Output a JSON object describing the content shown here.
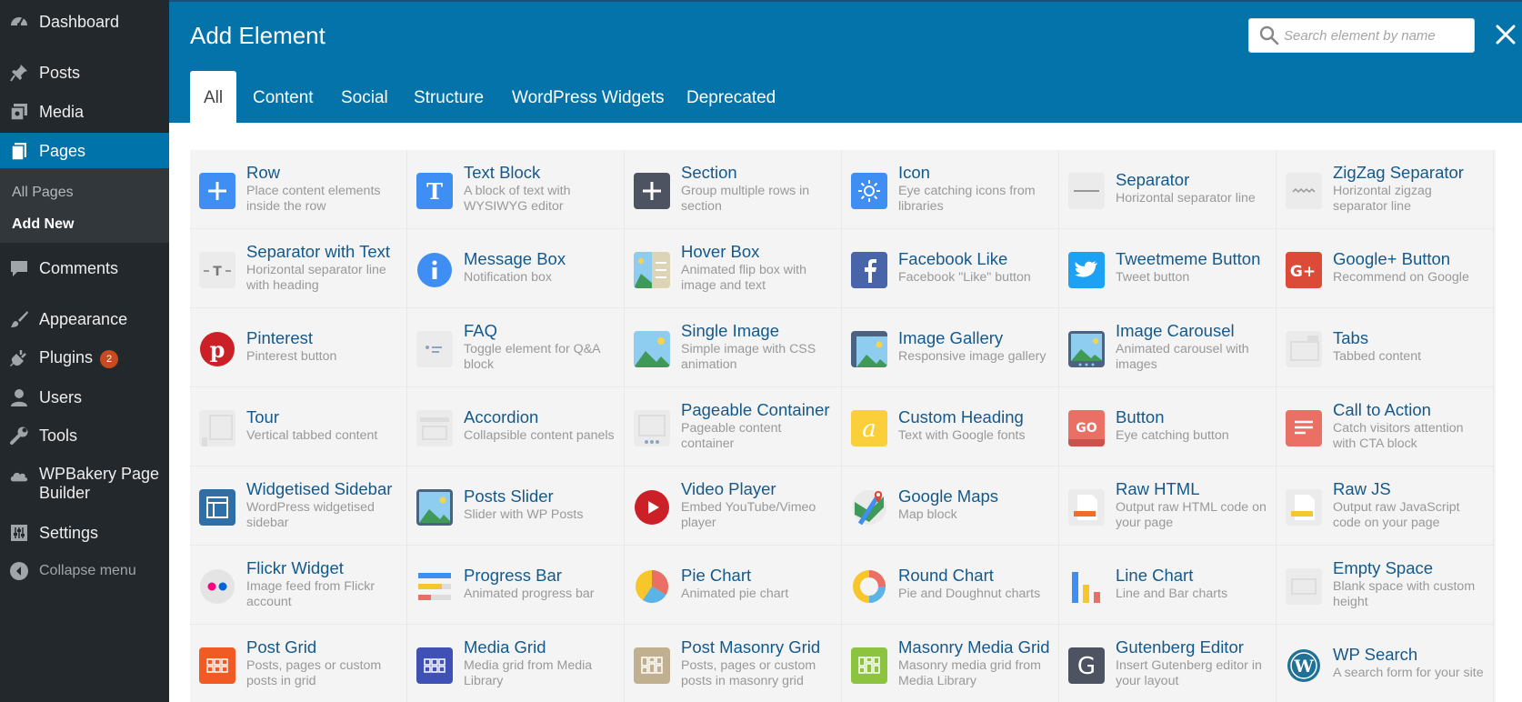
{
  "sidebar": {
    "items": [
      {
        "key": "dashboard",
        "label": "Dashboard",
        "icon": "gauge-icon"
      },
      {
        "key": "posts",
        "label": "Posts",
        "icon": "pushpin-icon"
      },
      {
        "key": "media",
        "label": "Media",
        "icon": "media-icon"
      },
      {
        "key": "pages",
        "label": "Pages",
        "icon": "pages-icon"
      },
      {
        "key": "comments",
        "label": "Comments",
        "icon": "comment-icon"
      },
      {
        "key": "appearance",
        "label": "Appearance",
        "icon": "paintbrush-icon"
      },
      {
        "key": "plugins",
        "label": "Plugins",
        "icon": "plug-icon"
      },
      {
        "key": "users",
        "label": "Users",
        "icon": "user-icon"
      },
      {
        "key": "tools",
        "label": "Tools",
        "icon": "wrench-icon"
      },
      {
        "key": "wpbakery",
        "label": "WPBakery Page Builder",
        "icon": "cloud-icon"
      },
      {
        "key": "settings",
        "label": "Settings",
        "icon": "sliders-icon"
      }
    ],
    "submenu": {
      "all_pages": "All Pages",
      "add_new": "Add New"
    },
    "plugins_badge": "2",
    "collapse_label": "Collapse menu"
  },
  "modal": {
    "title": "Add Element",
    "search_placeholder": "Search element by name",
    "tabs": [
      "All",
      "Content",
      "Social",
      "Structure",
      "WordPress Widgets",
      "Deprecated"
    ],
    "active_tab": "All",
    "elements": [
      {
        "name": "Row",
        "desc": "Place content elements inside the row",
        "icon": "plus-icon"
      },
      {
        "name": "Text Block",
        "desc": "A block of text with WYSIWYG editor",
        "icon": "text-block-icon"
      },
      {
        "name": "Section",
        "desc": "Group multiple rows in section",
        "icon": "section-plus-icon"
      },
      {
        "name": "Icon",
        "desc": "Eye catching icons from libraries",
        "icon": "sun-icon"
      },
      {
        "name": "Separator",
        "desc": "Horizontal separator line",
        "icon": "separator-icon"
      },
      {
        "name": "ZigZag Separator",
        "desc": "Horizontal zigzag separator line",
        "icon": "zigzag-icon"
      },
      {
        "name": "Separator with Text",
        "desc": "Horizontal separator line with heading",
        "icon": "separator-text-icon"
      },
      {
        "name": "Message Box",
        "desc": "Notification box",
        "icon": "info-icon"
      },
      {
        "name": "Hover Box",
        "desc": "Animated flip box with image and text",
        "icon": "hover-box-icon"
      },
      {
        "name": "Facebook Like",
        "desc": "Facebook \"Like\" button",
        "icon": "facebook-icon"
      },
      {
        "name": "Tweetmeme Button",
        "desc": "Tweet button",
        "icon": "twitter-icon"
      },
      {
        "name": "Google+ Button",
        "desc": "Recommend on Google",
        "icon": "google-plus-icon"
      },
      {
        "name": "Pinterest",
        "desc": "Pinterest button",
        "icon": "pinterest-icon"
      },
      {
        "name": "FAQ",
        "desc": "Toggle element for Q&A block",
        "icon": "faq-icon"
      },
      {
        "name": "Single Image",
        "desc": "Simple image with CSS animation",
        "icon": "image-icon"
      },
      {
        "name": "Image Gallery",
        "desc": "Responsive image gallery",
        "icon": "gallery-icon"
      },
      {
        "name": "Image Carousel",
        "desc": "Animated carousel with images",
        "icon": "carousel-icon"
      },
      {
        "name": "Tabs",
        "desc": "Tabbed content",
        "icon": "tabs-icon"
      },
      {
        "name": "Tour",
        "desc": "Vertical tabbed content",
        "icon": "tour-icon"
      },
      {
        "name": "Accordion",
        "desc": "Collapsible content panels",
        "icon": "accordion-icon"
      },
      {
        "name": "Pageable Container",
        "desc": "Pageable content container",
        "icon": "pageable-icon"
      },
      {
        "name": "Custom Heading",
        "desc": "Text with Google fonts",
        "icon": "heading-icon"
      },
      {
        "name": "Button",
        "desc": "Eye catching button",
        "icon": "go-button-icon"
      },
      {
        "name": "Call to Action",
        "desc": "Catch visitors attention with CTA block",
        "icon": "cta-icon"
      },
      {
        "name": "Widgetised Sidebar",
        "desc": "WordPress widgetised sidebar",
        "icon": "widget-sidebar-icon"
      },
      {
        "name": "Posts Slider",
        "desc": "Slider with WP Posts",
        "icon": "posts-slider-icon"
      },
      {
        "name": "Video Player",
        "desc": "Embed YouTube/Vimeo player",
        "icon": "play-icon"
      },
      {
        "name": "Google Maps",
        "desc": "Map block",
        "icon": "map-icon"
      },
      {
        "name": "Raw HTML",
        "desc": "Output raw HTML code on your page",
        "icon": "raw-html-icon"
      },
      {
        "name": "Raw JS",
        "desc": "Output raw JavaScript code on your page",
        "icon": "raw-js-icon"
      },
      {
        "name": "Flickr Widget",
        "desc": "Image feed from Flickr account",
        "icon": "flickr-icon"
      },
      {
        "name": "Progress Bar",
        "desc": "Animated progress bar",
        "icon": "progress-bar-icon"
      },
      {
        "name": "Pie Chart",
        "desc": "Animated pie chart",
        "icon": "pie-chart-icon"
      },
      {
        "name": "Round Chart",
        "desc": "Pie and Doughnut charts",
        "icon": "round-chart-icon"
      },
      {
        "name": "Line Chart",
        "desc": "Line and Bar charts",
        "icon": "bar-chart-icon"
      },
      {
        "name": "Empty Space",
        "desc": "Blank space with custom height",
        "icon": "empty-space-icon"
      },
      {
        "name": "Post Grid",
        "desc": "Posts, pages or custom posts in grid",
        "icon": "post-grid-icon"
      },
      {
        "name": "Media Grid",
        "desc": "Media grid from Media Library",
        "icon": "media-grid-icon"
      },
      {
        "name": "Post Masonry Grid",
        "desc": "Posts, pages or custom posts in masonry grid",
        "icon": "masonry-grid-icon"
      },
      {
        "name": "Masonry Media Grid",
        "desc": "Masonry media grid from Media Library",
        "icon": "masonry-media-icon"
      },
      {
        "name": "Gutenberg Editor",
        "desc": "Insert Gutenberg editor in your layout",
        "icon": "gutenberg-icon"
      },
      {
        "name": "WP Search",
        "desc": "A search form for your site",
        "icon": "wordpress-icon"
      }
    ]
  }
}
